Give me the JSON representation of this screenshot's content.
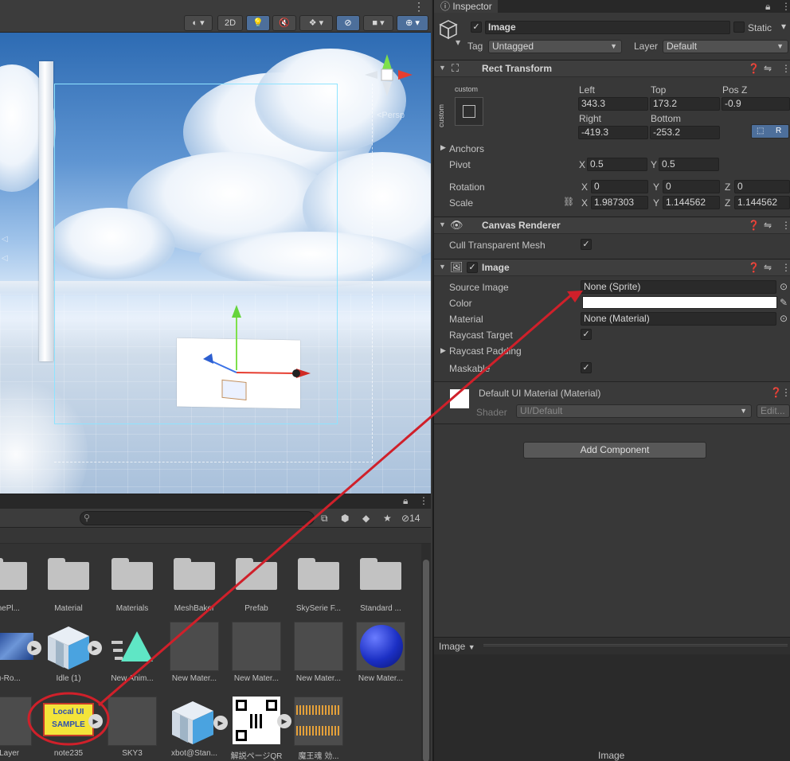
{
  "scene": {
    "toolbar": {
      "btn_2d": "2D"
    }
  },
  "project": {
    "hidden_count": "14",
    "assets": [
      {
        "label": "onePl...",
        "kind": "folder"
      },
      {
        "label": "Material",
        "kind": "folder"
      },
      {
        "label": "Materials",
        "kind": "folder"
      },
      {
        "label": "MeshBaker",
        "kind": "folder"
      },
      {
        "label": "Prefab",
        "kind": "folder"
      },
      {
        "label": "SkySerie F...",
        "kind": "folder"
      },
      {
        "label": "Standard ...",
        "kind": "folder"
      },
      {
        "label": "nu-Ro...",
        "kind": "image"
      },
      {
        "label": "Idle (1)",
        "kind": "model"
      },
      {
        "label": "New Anim...",
        "kind": "anim"
      },
      {
        "label": "New Mater...",
        "kind": "material"
      },
      {
        "label": "New Mater...",
        "kind": "material"
      },
      {
        "label": "New Mater...",
        "kind": "material"
      },
      {
        "label": "New Mater...",
        "kind": "sphere"
      },
      {
        "label": "wLayer",
        "kind": "gray"
      },
      {
        "label": "note235",
        "kind": "sample"
      },
      {
        "label": "SKY3",
        "kind": "gray"
      },
      {
        "label": "xbot@Stan...",
        "kind": "model"
      },
      {
        "label": "解説ページQR",
        "kind": "qr"
      },
      {
        "label": "魔王魂 効...",
        "kind": "audio"
      }
    ],
    "sample_thumb": {
      "line1": "Local  UI",
      "line2": "SAMPLE"
    }
  },
  "inspector": {
    "tab_label": "Inspector",
    "object": {
      "name": "Image",
      "static_label": "Static",
      "tag_label": "Tag",
      "tag_value": "Untagged",
      "layer_label": "Layer",
      "layer_value": "Default"
    },
    "rect_transform": {
      "title": "Rect Transform",
      "anchor_preset_top": "custom",
      "anchor_preset_side": "custom",
      "left_label": "Left",
      "left_value": "343.3",
      "top_label": "Top",
      "top_value": "173.2",
      "posz_label": "Pos Z",
      "posz_value": "-0.9",
      "right_label": "Right",
      "right_value": "-419.3",
      "bottom_label": "Bottom",
      "bottom_value": "-253.2",
      "raw_btn": "R",
      "anchors_label": "Anchors",
      "pivot_label": "Pivot",
      "pivot_x": "0.5",
      "pivot_y": "0.5",
      "rotation_label": "Rotation",
      "rot_x": "0",
      "rot_y": "0",
      "rot_z": "0",
      "scale_label": "Scale",
      "scale_x": "1.987303",
      "scale_y": "1.144562",
      "scale_z": "1.144562",
      "axis_x": "X",
      "axis_y": "Y",
      "axis_z": "Z"
    },
    "canvas_renderer": {
      "title": "Canvas Renderer",
      "cull_label": "Cull Transparent Mesh",
      "cull_checked": "✓"
    },
    "image": {
      "title": "Image",
      "source_image_label": "Source Image",
      "source_image_value": "None (Sprite)",
      "color_label": "Color",
      "color_value": "#ffffff",
      "material_label": "Material",
      "material_value": "None (Material)",
      "raycast_target_label": "Raycast Target",
      "raycast_target_checked": "✓",
      "raycast_padding_label": "Raycast Padding",
      "maskable_label": "Maskable",
      "maskable_checked": "✓"
    },
    "material_block": {
      "title": "Default UI Material (Material)",
      "shader_label": "Shader",
      "shader_value": "UI/Default",
      "edit_label": "Edit..."
    },
    "add_component": "Add Component",
    "preview": {
      "dropdown_label": "Image",
      "footer_label": "Image"
    }
  },
  "colors": {
    "annotation_red": "#d0202a",
    "accent_blue": "#4d6f9b"
  }
}
